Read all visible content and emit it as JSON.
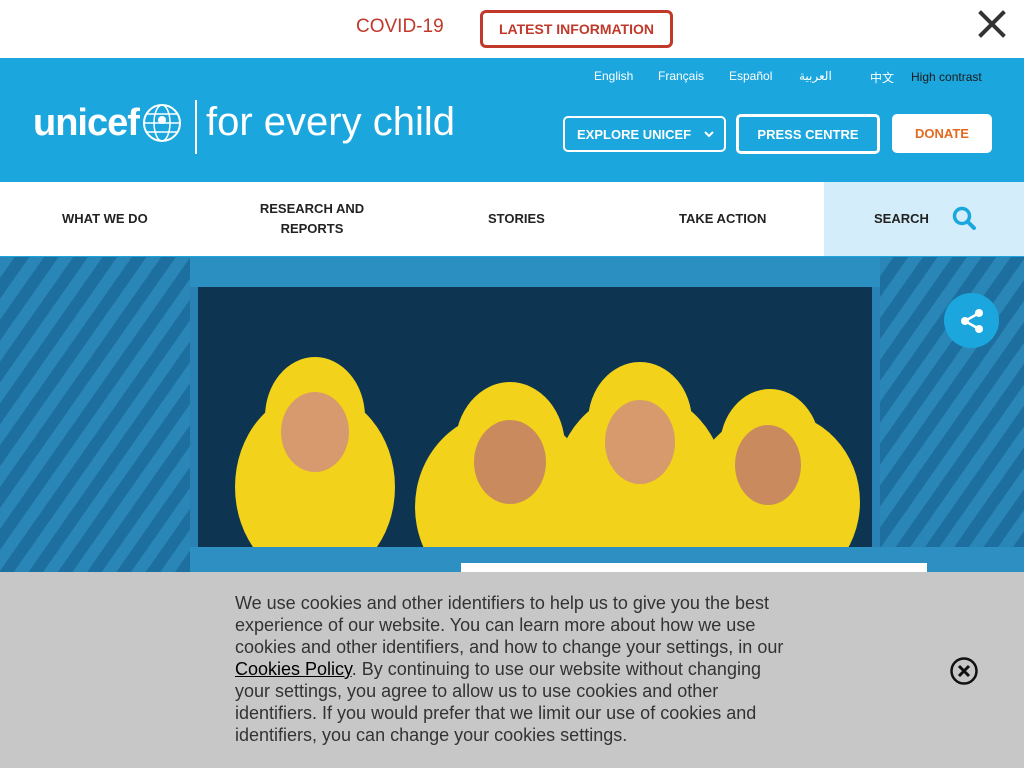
{
  "alert": {
    "covid_label": "COVID-19",
    "latest_label": "LATEST INFORMATION"
  },
  "header": {
    "languages": [
      "English",
      "Français",
      "Español",
      "العربية",
      "中文"
    ],
    "high_contrast": "High contrast",
    "logo_text": "unicef",
    "tagline": "for every child",
    "explore_label": "EXPLORE UNICEF",
    "press_label": "PRESS CENTRE",
    "donate_label": "DONATE"
  },
  "nav": {
    "what_we_do": "WHAT WE DO",
    "research_line1": "RESEARCH AND",
    "research_line2": "REPORTS",
    "stories": "STORIES",
    "take_action": "TAKE ACTION",
    "search": "SEARCH"
  },
  "cookie": {
    "text_before": "We use cookies and other identifiers to help us to give you the best experience of our website. You can learn more about how we use cookies and other identifiers, and how to change your settings, in our ",
    "link": "Cookies Policy",
    "text_after": ". By continuing to use our website without changing your settings, you agree to allow us to use cookies and other identifiers. If you would prefer that we limit our use of cookies and identifiers, you can change your cookies settings."
  },
  "colors": {
    "brand_blue": "#1ba7de",
    "alert_red": "#c0392b",
    "donate_orange": "#e36a1f",
    "cookie_bg": "#c7c7c7"
  },
  "icons": [
    "close-icon",
    "unicef-globe-icon",
    "chevron-down-icon",
    "search-icon",
    "share-icon",
    "circle-close-icon"
  ]
}
